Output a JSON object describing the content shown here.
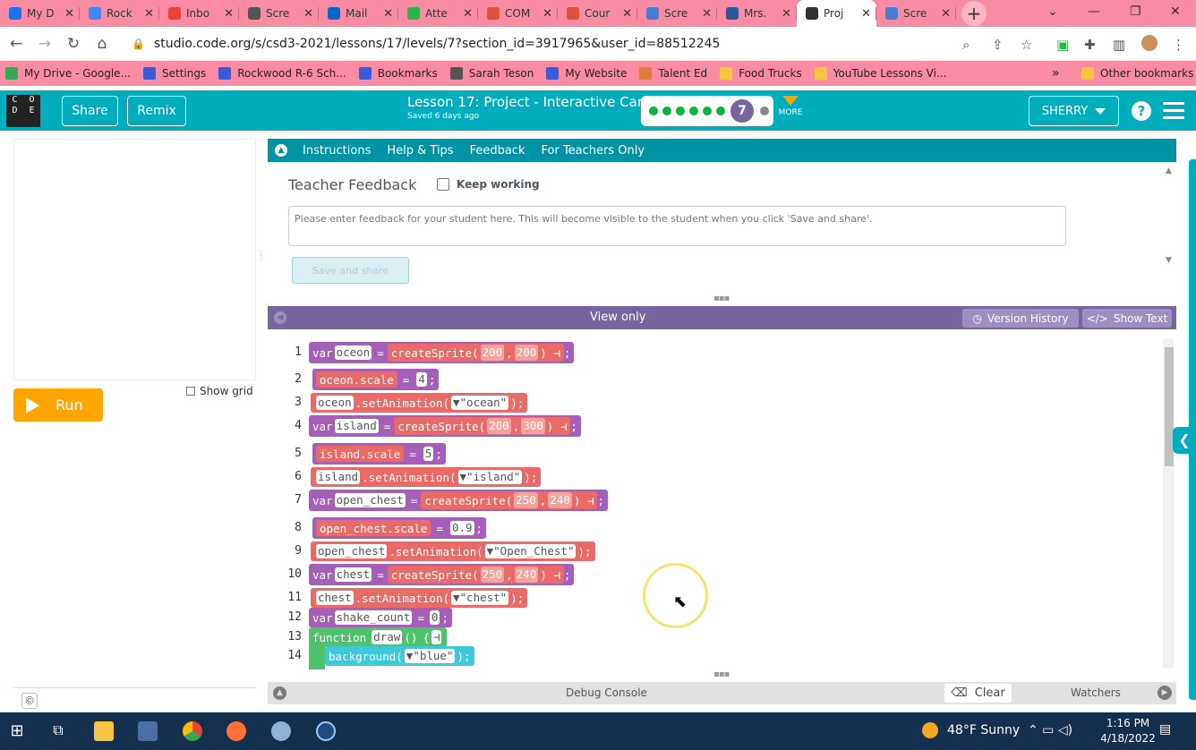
{
  "browser": {
    "tabs": [
      {
        "label": "My D",
        "color": "#1a73e8"
      },
      {
        "label": "Rock",
        "color": "#4285f4"
      },
      {
        "label": "Inbo",
        "color": "#ea4335"
      },
      {
        "label": "Scre",
        "color": "#555555"
      },
      {
        "label": "Mail",
        "color": "#0a64c8"
      },
      {
        "label": "Atte",
        "color": "#2db34a"
      },
      {
        "label": "COM",
        "color": "#e0523a"
      },
      {
        "label": "Cour",
        "color": "#e0523a"
      },
      {
        "label": "Scre",
        "color": "#4a7bd0"
      },
      {
        "label": "Mrs.",
        "color": "#2b579a"
      },
      {
        "label": "Proj",
        "color": "#333333"
      },
      {
        "label": "Scre",
        "color": "#4a7bd0"
      }
    ],
    "url": "studio.code.org/s/csd3-2021/lessons/17/levels/7?section_id=3917965&user_id=88512245",
    "bookmarks": [
      {
        "label": "My Drive - Google...",
        "icon": "drive-icon",
        "color": "#34a853"
      },
      {
        "label": "Settings",
        "icon": "gear-icon",
        "color": "#3b5bdb"
      },
      {
        "label": "Rockwood R-6 Sch...",
        "icon": "calendar-icon",
        "color": "#3b5bdb"
      },
      {
        "label": "Bookmarks",
        "icon": "star-icon",
        "color": "#3b5bdb"
      },
      {
        "label": "Sarah Teson",
        "icon": "wordpress-icon",
        "color": "#555555"
      },
      {
        "label": "My Website",
        "icon": "page-icon",
        "color": "#3b5bdb"
      },
      {
        "label": "Talent Ed",
        "icon": "talent-icon",
        "color": "#e07b39"
      },
      {
        "label": "Food Trucks",
        "icon": "folder-icon",
        "color": "#f6c543"
      },
      {
        "label": "YouTube Lessons Vi...",
        "icon": "folder-icon",
        "color": "#f6c543"
      }
    ],
    "overflow": "»",
    "other_bookmarks": "Other bookmarks"
  },
  "header": {
    "logo_letters": [
      "C",
      "O",
      "D",
      "E",
      "",
      ""
    ],
    "share": "Share",
    "remix": "Remix",
    "lesson_title": "Lesson 17: Project - Interactive Card",
    "saved": "Saved 6 days ago",
    "current_level": "7",
    "more": "MORE",
    "user": "SHERRY",
    "help": "?"
  },
  "left": {
    "run": "Run",
    "show_grid": "Show grid",
    "copyright": "©"
  },
  "instructions": {
    "tabs": [
      "Instructions",
      "Help & Tips",
      "Feedback",
      "For Teachers Only"
    ],
    "feedback_title": "Teacher Feedback",
    "keep_working": "Keep working",
    "placeholder": "Please enter feedback for your student here. This will become visible to the student when you click 'Save and share'.",
    "save": "Save and share"
  },
  "code": {
    "view_only": "View only",
    "version_history": "Version History",
    "show_text": "Show Text",
    "line_numbers": [
      "1",
      "2",
      "3",
      "4",
      "5",
      "6",
      "7",
      "8",
      "9",
      "10",
      "11",
      "12",
      "13",
      "14"
    ],
    "lines": {
      "l1": {
        "kw": "var",
        "name": "oceon",
        "eq": "=",
        "fn": "createSprite",
        "a": "200",
        "b": "200"
      },
      "l2": {
        "name": "oceon.scale",
        "eq": "=",
        "val": "4"
      },
      "l3": {
        "obj": "oceon",
        "method": ".setAnimation(",
        "arg": "\"ocean\""
      },
      "l4": {
        "kw": "var",
        "name": "island",
        "eq": "=",
        "fn": "createSprite",
        "a": "200",
        "b": "300"
      },
      "l5": {
        "name": "island.scale",
        "eq": "=",
        "val": "5"
      },
      "l6": {
        "obj": "island",
        "method": ".setAnimation(",
        "arg": "\"island\""
      },
      "l7": {
        "kw": "var",
        "name": "open_chest",
        "eq": "=",
        "fn": "createSprite",
        "a": "250",
        "b": "240"
      },
      "l8": {
        "name": "open_chest.scale",
        "eq": "=",
        "val": "0.9"
      },
      "l9": {
        "obj": "open_chest",
        "method": ".setAnimation(",
        "arg": "\"Open_Chest\""
      },
      "l10": {
        "kw": "var",
        "name": "chest",
        "eq": "=",
        "fn": "createSprite",
        "a": "250",
        "b": "240"
      },
      "l11": {
        "obj": "chest",
        "method": ".setAnimation(",
        "arg": "\"chest\""
      },
      "l12": {
        "kw": "var",
        "name": "shake_count",
        "eq": "=",
        "val": "0"
      },
      "l13": {
        "kw": "function",
        "name": "draw",
        "parens": "()",
        "brace": "{"
      },
      "l14": {
        "fn": "background(",
        "arg": "\"blue\""
      }
    }
  },
  "debug": {
    "label": "Debug Console",
    "clear": "Clear",
    "watchers": "Watchers"
  },
  "taskbar": {
    "weather": "48°F  Sunny",
    "time": "1:16 PM",
    "date": "4/18/2022"
  }
}
